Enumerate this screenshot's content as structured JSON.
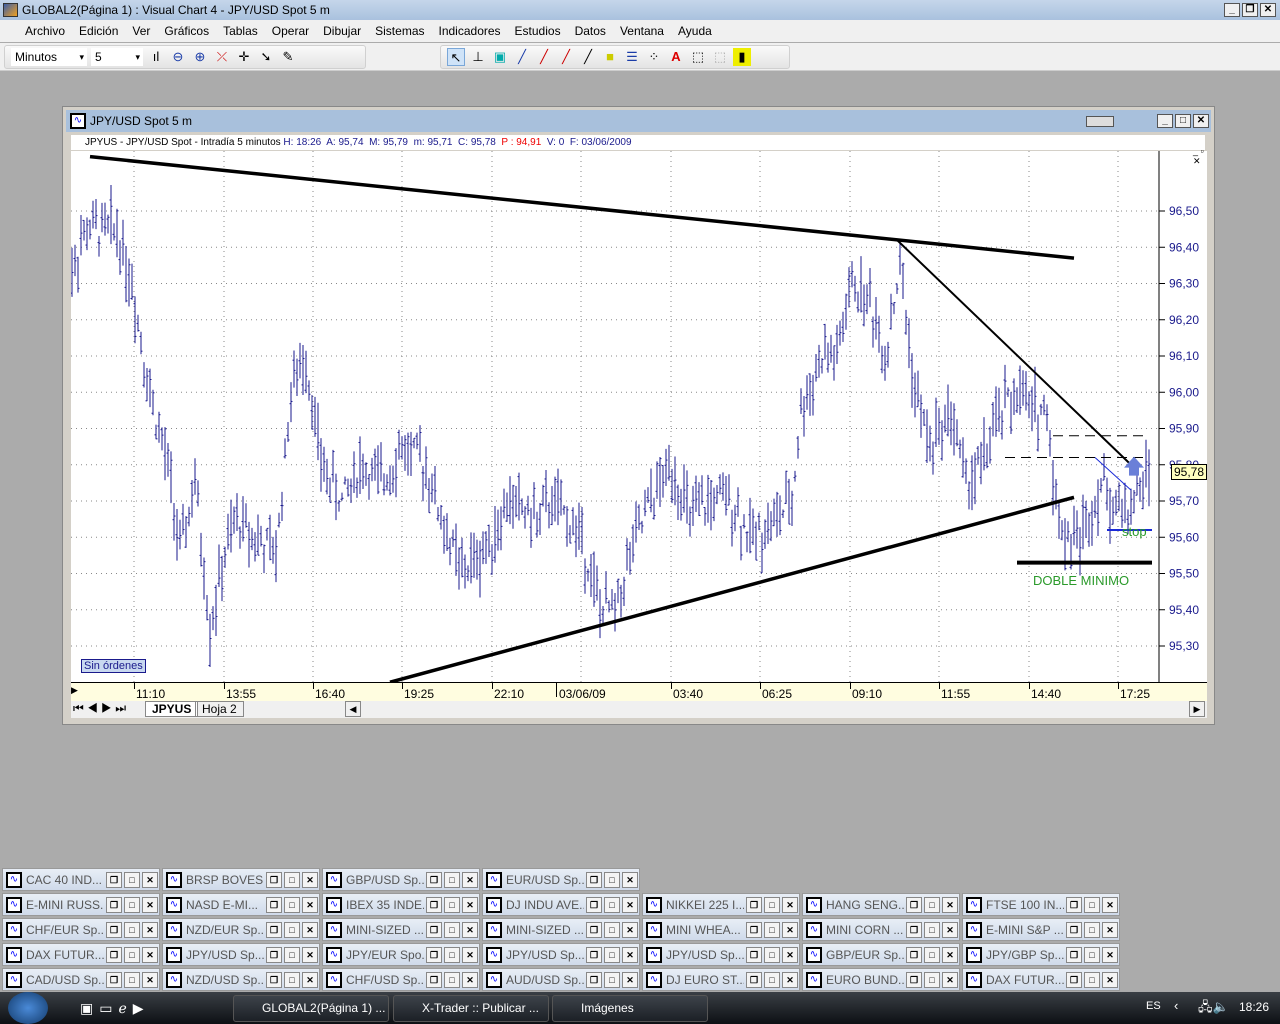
{
  "app": {
    "title": "GLOBAL2(Página 1) : Visual Chart 4 - JPY/USD Spot 5 m"
  },
  "menu": [
    "Archivo",
    "Edición",
    "Ver",
    "Gráficos",
    "Tablas",
    "Operar",
    "Dibujar",
    "Sistemas",
    "Indicadores",
    "Estudios",
    "Datos",
    "Ventana",
    "Ayuda"
  ],
  "toolbar": {
    "period_unit": "Minutos",
    "period_value": "5"
  },
  "chart_window": {
    "title": "JPY/USD Spot 5 m",
    "info": {
      "symbol": "JPYUS - JPY/USD Spot - Intradía 5 minutos",
      "h": "H: 18:26",
      "a": "A: 95,74",
      "m": "M: 95,79",
      "min": "m: 95,71",
      "c": "C: 95,78",
      "p": "P : 94,91",
      "v": "V: 0",
      "f": "F: 03/06/2009"
    },
    "orders_label": "Sin órdenes",
    "last_price": "95,78",
    "annotations": {
      "stop": "stop",
      "double_min": "DOBLE MINIMO"
    },
    "sheets": [
      "JPYUS",
      "Hoja 2"
    ]
  },
  "chart_data": {
    "type": "ohlc-bars",
    "symbol": "JPY/USD Spot",
    "interval": "5 m",
    "y_ticks": [
      "96,50",
      "96,40",
      "96,30",
      "96,20",
      "96,10",
      "96,00",
      "95,90",
      "95,80",
      "95,70",
      "95,60",
      "95,50",
      "95,40",
      "95,30"
    ],
    "ylim": [
      95.2,
      96.65
    ],
    "x_ticks": [
      "11:10",
      "13:55",
      "16:40",
      "19:25",
      "22:10",
      "03/06/09",
      "03:40",
      "06:25",
      "09:10",
      "11:55",
      "14:40",
      "17:25"
    ],
    "bar_count": 362,
    "price_path": [
      [
        0,
        96.3
      ],
      [
        7,
        96.45
      ],
      [
        17,
        96.45
      ],
      [
        22,
        96.3
      ],
      [
        28,
        96.0
      ],
      [
        35,
        95.75
      ],
      [
        38,
        95.55
      ],
      [
        43,
        95.75
      ],
      [
        48,
        95.35
      ],
      [
        53,
        95.55
      ],
      [
        57,
        95.65
      ],
      [
        63,
        95.6
      ],
      [
        70,
        95.55
      ],
      [
        75,
        96.0
      ],
      [
        80,
        96.1
      ],
      [
        85,
        95.8
      ],
      [
        92,
        95.7
      ],
      [
        98,
        95.8
      ],
      [
        105,
        95.75
      ],
      [
        112,
        95.85
      ],
      [
        120,
        95.8
      ],
      [
        125,
        95.65
      ],
      [
        132,
        95.5
      ],
      [
        138,
        95.55
      ],
      [
        142,
        95.6
      ],
      [
        148,
        95.7
      ],
      [
        157,
        95.65
      ],
      [
        162,
        95.7
      ],
      [
        167,
        95.65
      ],
      [
        172,
        95.6
      ],
      [
        178,
        95.4
      ],
      [
        183,
        95.4
      ],
      [
        188,
        95.55
      ],
      [
        195,
        95.7
      ],
      [
        202,
        95.8
      ],
      [
        208,
        95.65
      ],
      [
        215,
        95.7
      ],
      [
        222,
        95.7
      ],
      [
        228,
        95.6
      ],
      [
        237,
        95.65
      ],
      [
        242,
        95.7
      ],
      [
        245,
        95.95
      ],
      [
        252,
        96.1
      ],
      [
        257,
        96.1
      ],
      [
        262,
        96.3
      ],
      [
        268,
        96.25
      ],
      [
        273,
        96.1
      ],
      [
        278,
        96.35
      ],
      [
        283,
        96.0
      ],
      [
        288,
        95.85
      ],
      [
        295,
        95.95
      ],
      [
        300,
        95.75
      ],
      [
        305,
        95.8
      ],
      [
        312,
        95.95
      ],
      [
        317,
        96.0
      ],
      [
        322,
        95.95
      ],
      [
        327,
        95.95
      ],
      [
        330,
        95.7
      ],
      [
        333,
        95.6
      ],
      [
        338,
        95.6
      ],
      [
        345,
        95.75
      ],
      [
        350,
        95.68
      ],
      [
        355,
        95.68
      ],
      [
        361,
        95.78
      ]
    ],
    "trendlines": [
      {
        "name": "resistance",
        "from": [
          8,
          96.65
        ],
        "to": [
          336,
          96.37
        ]
      },
      {
        "name": "support",
        "from": [
          108,
          95.2
        ],
        "to": [
          336,
          95.71
        ]
      },
      {
        "name": "short-resistance",
        "from": [
          277,
          96.42
        ],
        "to": [
          355,
          95.8
        ]
      }
    ],
    "levels": [
      {
        "name": "double-min",
        "price": 95.53,
        "from": 317,
        "to": 362
      },
      {
        "name": "stop",
        "price": 95.62,
        "from": 347,
        "to": 362
      },
      {
        "name": "dash-upper",
        "price": 95.88,
        "from": 329,
        "to": 360
      },
      {
        "name": "dash-lower",
        "price": 95.82,
        "from": 313,
        "to": 361
      }
    ]
  },
  "minimized": [
    [
      "CAC 40 IND...",
      "BRSP BOVES...",
      "GBP/USD Sp...",
      "EUR/USD Sp..."
    ],
    [
      "E-MINI RUSS...",
      "NASD E-MI...",
      "IBEX 35 INDE...",
      "DJ INDU AVE...",
      "NIKKEI 225 I...",
      "HANG SENG...",
      "FTSE 100 IN..."
    ],
    [
      "CHF/EUR Sp...",
      "NZD/EUR Sp...",
      "MINI-SIZED ...",
      "MINI-SIZED ...",
      "MINI WHEA...",
      "MINI CORN ...",
      "E-MINI S&P ..."
    ],
    [
      "DAX FUTUR...",
      "JPY/USD Sp...",
      "JPY/EUR Spo...",
      "JPY/USD Sp...",
      "JPY/USD Sp...",
      "GBP/EUR Sp...",
      "JPY/GBP Sp..."
    ],
    [
      "CAD/USD Sp...",
      "NZD/USD Sp...",
      "CHF/USD Sp...",
      "AUD/USD Sp...",
      "DJ EURO ST...",
      "EURO BUND...",
      "DAX FUTUR..."
    ]
  ],
  "taskbar": {
    "tasks": [
      "GLOBAL2(Página 1) ...",
      "X-Trader :: Publicar ...",
      "Imágenes"
    ],
    "lang": "ES",
    "clock": "18:26"
  },
  "colors": {
    "bars": "#1a1a8c",
    "annotation": "#2a9a2a",
    "arrow": "#6a7fd8",
    "price_axis": "#1a1a8c"
  }
}
